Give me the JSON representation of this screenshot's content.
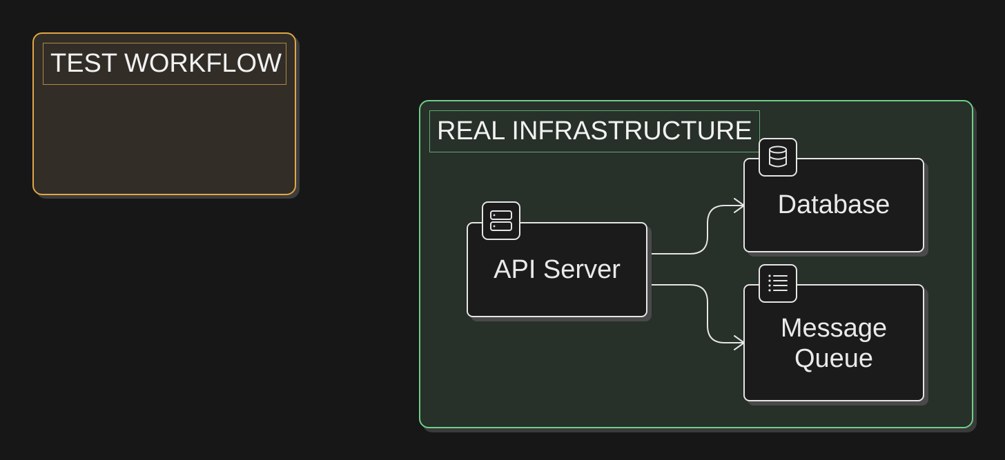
{
  "groups": {
    "test": {
      "title": "TEST WORKFLOW",
      "border_color": "#e3a646",
      "fill_color": "#322e27"
    },
    "real": {
      "title": "REAL INFRASTRUCTURE",
      "border_color": "#6ed08a",
      "fill_color": "#273029"
    }
  },
  "nodes": {
    "api": {
      "label": "API Server",
      "icon": "server-icon"
    },
    "db": {
      "label": "Database",
      "icon": "database-icon"
    },
    "mq": {
      "label_line1": "Message",
      "label_line2": "Queue",
      "icon": "list-icon"
    }
  },
  "edges": [
    {
      "from": "API Server",
      "to": "Database"
    },
    {
      "from": "API Server",
      "to": "Message Queue"
    }
  ]
}
